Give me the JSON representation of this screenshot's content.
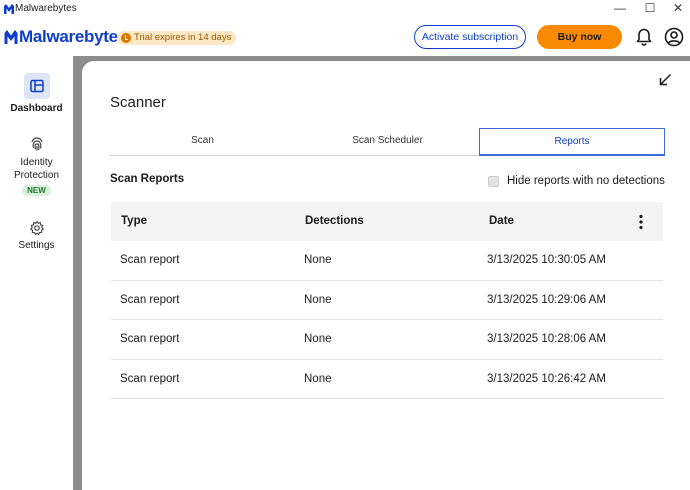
{
  "window": {
    "title": "Malwarebytes",
    "minimize": "—",
    "maximize": "☐",
    "close": "✕"
  },
  "header": {
    "logo_text": "Malwarebytes",
    "trial_text": "Trial expires in 14 days",
    "activate_label": "Activate subscription",
    "buy_label": "Buy now",
    "brand_color": "#0d3ecc",
    "buy_color": "#f78a00"
  },
  "sidebar": {
    "items": [
      {
        "label": "Dashboard",
        "icon": "dashboard-icon",
        "active": true
      },
      {
        "label": "Identity Protection",
        "icon": "fingerprint-icon",
        "badge": "NEW"
      },
      {
        "label": "Settings",
        "icon": "gear-icon"
      }
    ]
  },
  "main": {
    "title": "Scanner",
    "tabs": [
      {
        "label": "Scan"
      },
      {
        "label": "Scan Scheduler"
      },
      {
        "label": "Reports",
        "selected": true
      }
    ],
    "section_title": "Scan Reports",
    "hide_label": "Hide reports with no detections",
    "hide_checked": false
  },
  "table": {
    "columns": [
      "Type",
      "Detections",
      "Date"
    ],
    "rows": [
      {
        "type": "Scan report",
        "detections": "None",
        "date": "3/13/2025 10:30:05 AM"
      },
      {
        "type": "Scan report",
        "detections": "None",
        "date": "3/13/2025 10:29:06 AM"
      },
      {
        "type": "Scan report",
        "detections": "None",
        "date": "3/13/2025 10:28:06 AM"
      },
      {
        "type": "Scan report",
        "detections": "None",
        "date": "3/13/2025 10:26:42 AM"
      }
    ]
  }
}
